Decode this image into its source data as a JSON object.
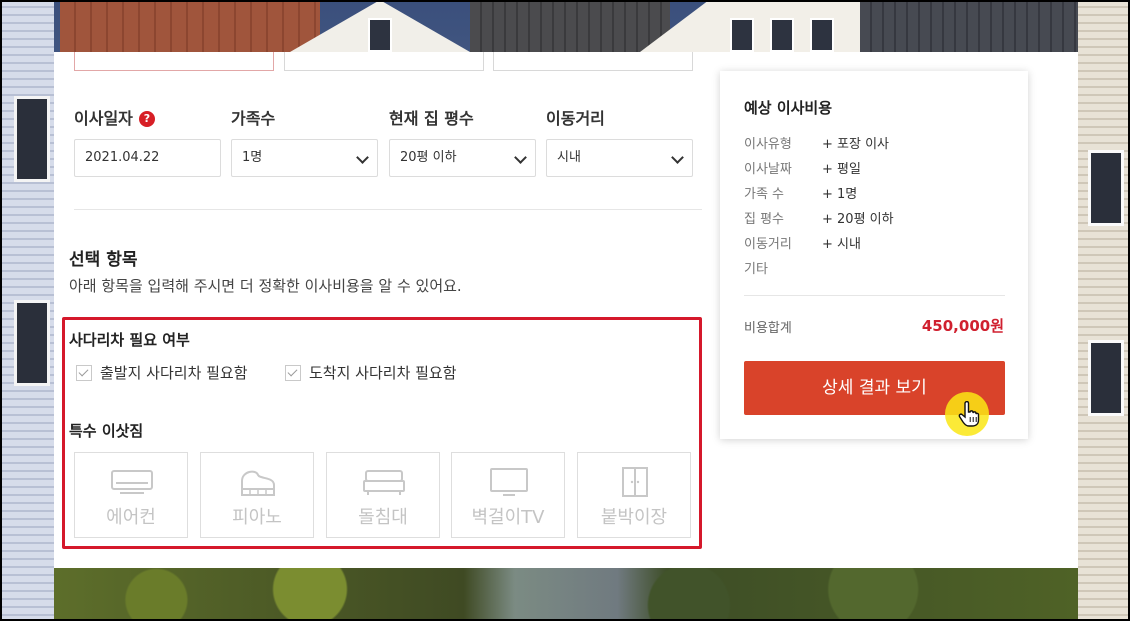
{
  "move_form": {
    "date": {
      "label": "이사일자",
      "help_icon": "?",
      "value": "2021.04.22"
    },
    "family": {
      "label": "가족수",
      "selected": "1명"
    },
    "house_size": {
      "label": "현재 집 평수",
      "selected": "20평 이하"
    },
    "distance": {
      "label": "이동거리",
      "selected": "시내"
    }
  },
  "options_section": {
    "title": "선택 항목",
    "subtitle": "아래 항목을 입력해 주시면 더 정확한 이사비용을 알 수 있어요.",
    "ladder": {
      "title": "사다리차 필요 여부",
      "departure": "출발지 사다리차 필요함",
      "arrival": "도착지 사다리차 필요함"
    },
    "special_items": {
      "title": "특수 이삿짐",
      "items": [
        {
          "label": "에어컨",
          "icon": "air-conditioner-icon"
        },
        {
          "label": "피아노",
          "icon": "piano-icon"
        },
        {
          "label": "돌침대",
          "icon": "bed-icon"
        },
        {
          "label": "벽걸이TV",
          "icon": "tv-icon"
        },
        {
          "label": "붙박이장",
          "icon": "wardrobe-icon"
        }
      ]
    }
  },
  "summary": {
    "title": "예상 이사비용",
    "rows": [
      {
        "label": "이사유형",
        "value": "+ 포장 이사"
      },
      {
        "label": "이사날짜",
        "value": "+ 평일"
      },
      {
        "label": "가족 수",
        "value": "+ 1명"
      },
      {
        "label": "집 평수",
        "value": "+ 20평 이하"
      },
      {
        "label": "이동거리",
        "value": "+ 시내"
      },
      {
        "label": "기타",
        "value": ""
      }
    ],
    "total_label": "비용합계",
    "total_value": "450,000원",
    "cta_label": "상세 결과 보기"
  },
  "colors": {
    "accent_red": "#d5182b",
    "cta_orange": "#d9432a",
    "total_red": "#d0202f"
  }
}
